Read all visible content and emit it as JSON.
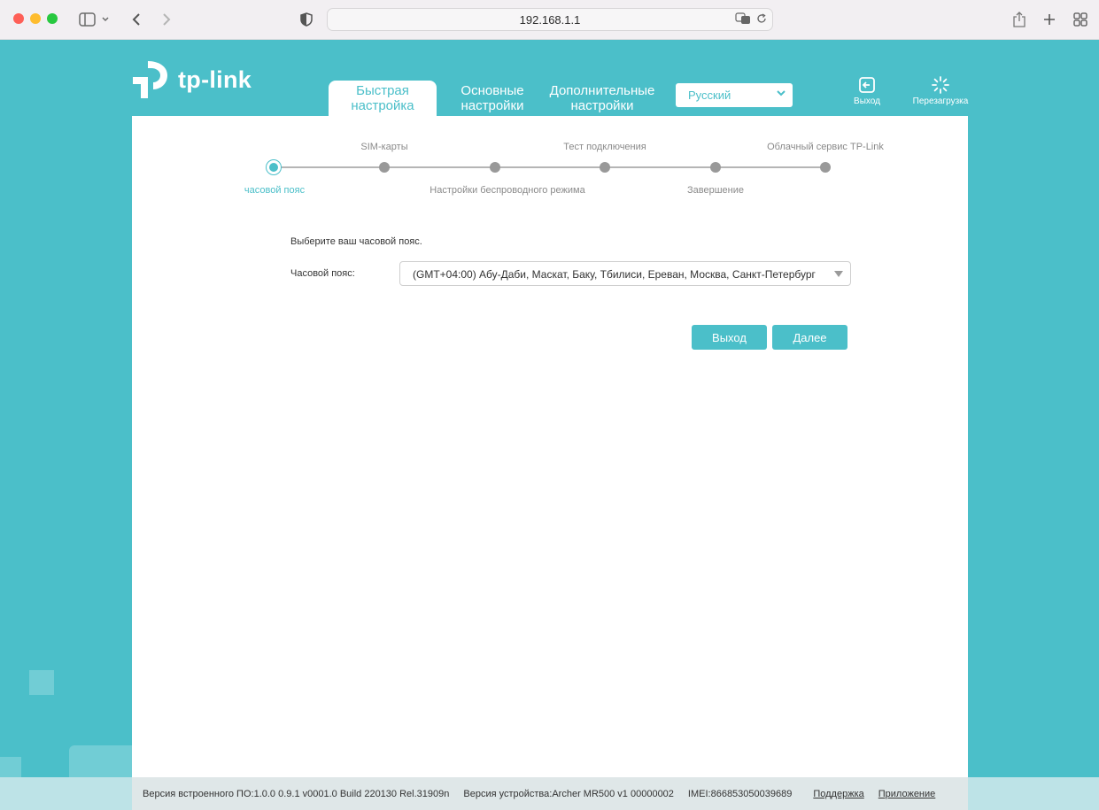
{
  "browser": {
    "url": "192.168.1.1"
  },
  "router": {
    "logo_text": "tp-link",
    "tabs": [
      {
        "label": "Быстрая\nнастройка",
        "active": true
      },
      {
        "label": "Основные\nнастройки",
        "active": false
      },
      {
        "label": "Дополнительные\nнастройки",
        "active": false
      }
    ],
    "language": "Русский",
    "exit_label": "Выход",
    "reboot_label": "Перезагрузка"
  },
  "wizard": {
    "steps": [
      {
        "label": "часовой пояс",
        "active": true
      },
      {
        "label": "SIM-карты",
        "active": false
      },
      {
        "label": "Настройки беспроводного режима",
        "active": false
      },
      {
        "label": "Тест подключения",
        "active": false
      },
      {
        "label": "Завершение",
        "active": false
      },
      {
        "label": "Облачный сервис TP-Link",
        "active": false
      }
    ],
    "intro": "Выберите ваш часовой пояс.",
    "tz_label": "Часовой пояс:",
    "tz_value": "(GMT+04:00) Абу-Даби, Маскат, Баку, Тбилиси, Ереван, Москва, Санкт-Петербург",
    "exit_button": "Выход",
    "next_button": "Далее"
  },
  "footer": {
    "firmware": "Версия встроенного ПО:1.0.0 0.9.1 v0001.0 Build 220130 Rel.31909n",
    "hardware": "Версия устройства:Archer MR500 v1 00000002",
    "imei": "IMEI:866853050039689",
    "support": "Поддержка",
    "app": "Приложение"
  },
  "colors": {
    "accent": "#4bbfc9",
    "panel": "#ffffff"
  }
}
